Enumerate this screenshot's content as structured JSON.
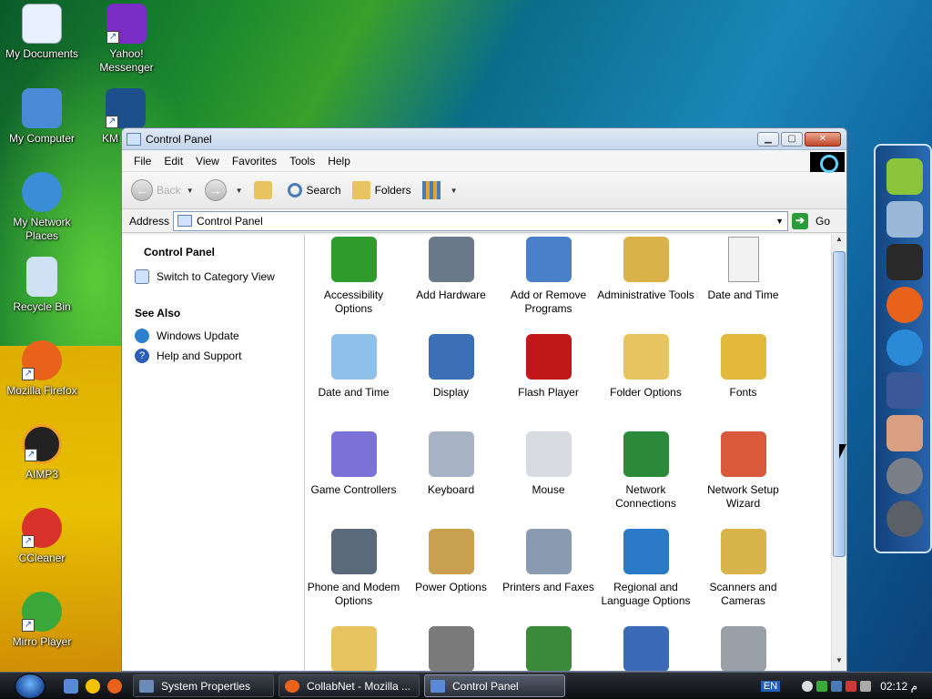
{
  "desktop": {
    "icons": [
      {
        "label": "My Documents",
        "icon": "documents-icon",
        "color": "#e8f1ff"
      },
      {
        "label": "Yahoo! Messenger",
        "icon": "yahoo-messenger-icon",
        "color": "#7a2cc4"
      },
      {
        "label": "My Computer",
        "icon": "computer-icon",
        "color": "#4b8ad6"
      },
      {
        "label": "KM",
        "icon": "kmplayer-icon",
        "color": "#1d4f8d"
      },
      {
        "label": "My Network Places",
        "icon": "network-places-icon",
        "color": "#3a8ed8"
      },
      {
        "label": "Recycle Bin",
        "icon": "recycle-bin-icon",
        "color": "#cfe1f5"
      },
      {
        "label": "Mozilla Firefox",
        "icon": "firefox-icon",
        "color": "#e8621c"
      },
      {
        "label": "AIMP3",
        "icon": "aimp-icon",
        "color": "#f0a020"
      },
      {
        "label": "CCleaner",
        "icon": "ccleaner-icon",
        "color": "#d8322a"
      },
      {
        "label": "Mirro Player",
        "icon": "mirro-player-icon",
        "color": "#3aa83a"
      }
    ]
  },
  "window": {
    "title": "Control Panel",
    "menu": [
      "File",
      "Edit",
      "View",
      "Favorites",
      "Tools",
      "Help"
    ],
    "toolbar": {
      "back": "Back",
      "search": "Search",
      "folders": "Folders"
    },
    "address": {
      "label": "Address",
      "value": "Control Panel",
      "go": "Go"
    },
    "left_pane": {
      "title": "Control Panel",
      "switch_view": "Switch to Category View",
      "see_also": "See Also",
      "links": [
        {
          "label": "Windows Update",
          "icon": "windows-update-icon",
          "color": "#2f7fd0"
        },
        {
          "label": "Help and Support",
          "icon": "help-icon",
          "color": "#2a5cb8"
        }
      ]
    },
    "items": [
      {
        "label": "Accessibility Options",
        "icon": "accessibility-icon",
        "color": "#2e9b2e"
      },
      {
        "label": "Add Hardware",
        "icon": "add-hardware-icon",
        "color": "#6a7a8a"
      },
      {
        "label": "Add or Remove Programs",
        "icon": "add-remove-programs-icon",
        "color": "#4a80c8"
      },
      {
        "label": "Administrative Tools",
        "icon": "admin-tools-icon",
        "color": "#d9b24a"
      },
      {
        "label": "Date and Time",
        "icon": "document-icon",
        "color": "#f2f2f2"
      },
      {
        "label": "Date and Time",
        "icon": "calendar-clock-icon",
        "color": "#8ec0ea"
      },
      {
        "label": "Display",
        "icon": "display-icon",
        "color": "#3b6fb5"
      },
      {
        "label": "Flash Player",
        "icon": "flash-player-icon",
        "color": "#c01818"
      },
      {
        "label": "Folder Options",
        "icon": "folder-options-icon",
        "color": "#e8c460"
      },
      {
        "label": "Fonts",
        "icon": "fonts-folder-icon",
        "color": "#e2b93a"
      },
      {
        "label": "Game Controllers",
        "icon": "game-controller-icon",
        "color": "#7a72d6"
      },
      {
        "label": "Keyboard",
        "icon": "keyboard-icon",
        "color": "#a8b4c6"
      },
      {
        "label": "Mouse",
        "icon": "mouse-icon",
        "color": "#d8dce2"
      },
      {
        "label": "Network Connections",
        "icon": "network-connections-icon",
        "color": "#2a8a3a"
      },
      {
        "label": "Network Setup Wizard",
        "icon": "network-setup-icon",
        "color": "#d85a3a"
      },
      {
        "label": "Phone and Modem Options",
        "icon": "phone-modem-icon",
        "color": "#5a6a7a"
      },
      {
        "label": "Power Options",
        "icon": "power-options-icon",
        "color": "#c8a050"
      },
      {
        "label": "Printers and Faxes",
        "icon": "printer-icon",
        "color": "#8a9ab0"
      },
      {
        "label": "Regional and Language Options",
        "icon": "globe-icon",
        "color": "#2a7ac8"
      },
      {
        "label": "Scanners and Cameras",
        "icon": "scanner-camera-icon",
        "color": "#d8b44a"
      },
      {
        "label": "",
        "icon": "scheduled-tasks-icon",
        "color": "#e8c460"
      },
      {
        "label": "",
        "icon": "sounds-icon",
        "color": "#7a7a7a"
      },
      {
        "label": "",
        "icon": "speech-icon",
        "color": "#3a8a3a"
      },
      {
        "label": "",
        "icon": "system-icon",
        "color": "#3a6ab8"
      },
      {
        "label": "",
        "icon": "taskbar-icon",
        "color": "#9aa0a8"
      }
    ]
  },
  "dock": [
    {
      "icon": "android-icon",
      "color": "#8ac43a"
    },
    {
      "icon": "satellite-icon",
      "color": "#9ab8d8"
    },
    {
      "icon": "tablet-icon",
      "color": "#2a2a2a"
    },
    {
      "icon": "firefox-icon",
      "color": "#e8621c"
    },
    {
      "icon": "internet-explorer-icon",
      "color": "#2a8ad8"
    },
    {
      "icon": "facebook-icon",
      "color": "#3b5998"
    },
    {
      "icon": "support-agent-icon",
      "color": "#d8a080"
    },
    {
      "icon": "settings-gear-icon",
      "color": "#7a7f88"
    },
    {
      "icon": "trash-icon",
      "color": "#5a5f68"
    }
  ],
  "taskbar": {
    "tasks": [
      {
        "label": "System Properties",
        "icon": "system-properties-icon",
        "color": "#6a8ab8"
      },
      {
        "label": "CollabNet - Mozilla ...",
        "icon": "firefox-icon",
        "color": "#e8621c"
      },
      {
        "label": "Control Panel",
        "icon": "control-panel-icon",
        "color": "#5a8ad6"
      }
    ],
    "lang": "EN",
    "clock": "02:12 م"
  }
}
